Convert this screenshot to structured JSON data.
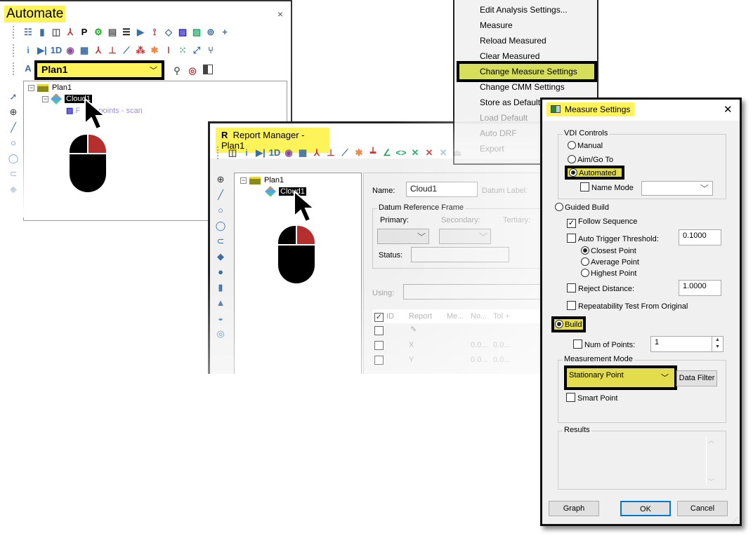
{
  "automate": {
    "title": "Automate",
    "close": "×",
    "toolbar1": [
      "report-icon",
      "page-icon",
      "camera-icon",
      "axis-icon",
      "P",
      "probe-icon",
      "document-icon",
      "list-icon",
      "play-icon",
      "robot-icon",
      "tag-icon",
      "scan-icon",
      "scan-color-icon",
      "target-icon",
      "plus-icon"
    ],
    "toolbar2": [
      "info-icon",
      "step-icon",
      "1D",
      "eye-icon",
      "grid-icon",
      "axis-circle-icon",
      "axis-square-icon",
      "chart-icon",
      "multi-circle-icon",
      "color-icon",
      "thermometer-icon",
      "dots-icon",
      "arrows-icon",
      "branch-icon"
    ],
    "plan_select": "Plan1",
    "tree": {
      "plan": "Plan1",
      "cloud": "Cloud1",
      "scan_prefix": "F",
      "scan": "4 points - scan"
    }
  },
  "report_manager": {
    "title": "Report Manager - Plan1",
    "title_icon": "R",
    "toolbar": [
      "camera-icon",
      "info-icon",
      "step-icon",
      "1D",
      "eye-icon",
      "grid-icon",
      "axis-circle-icon",
      "axis-square-icon",
      "chart-icon",
      "color-icon",
      "ruler-icon",
      "angle-icon",
      "code-icon",
      "cross-icon",
      "cross2-icon",
      "cross3-icon",
      "export-icon"
    ],
    "tree": {
      "plan": "Plan1",
      "cloud": "Cloud1"
    },
    "name_label": "Name:",
    "name_value": "Cloud1",
    "datum_label": "Datum Label:",
    "drf_group": "Datum Reference Frame",
    "primary": "Primary:",
    "secondary": "Secondary:",
    "tertiary": "Tertiary:",
    "status": "Status:",
    "using": "Using:",
    "columns": [
      "ID",
      "Report",
      "Me...",
      "No...",
      "Tol +"
    ],
    "rows": [
      {
        "report": "X",
        "nom": "0.0...",
        "tol": "0.0..."
      },
      {
        "report": "Y",
        "nom": "0.0...",
        "tol": "0.0..."
      }
    ]
  },
  "context_menu": {
    "items": [
      {
        "label": "Edit Analysis Settings...",
        "enabled": true
      },
      {
        "label": "Measure",
        "enabled": true
      },
      {
        "label": "Reload Measured",
        "enabled": true
      },
      {
        "label": "Clear Measured",
        "enabled": true
      },
      {
        "label": "Change Measure Settings",
        "enabled": true,
        "highlighted": true
      },
      {
        "label": "Change CMM Settings",
        "enabled": true
      },
      {
        "label": "Store as Default",
        "enabled": true
      },
      {
        "label": "Load Default",
        "enabled": false
      },
      {
        "label": "Auto DRF",
        "enabled": false
      },
      {
        "label": "Export",
        "enabled": false
      }
    ]
  },
  "measure_settings": {
    "title": "Measure Settings",
    "close": "✕",
    "vdi_group": "VDI Controls",
    "manual": "Manual",
    "aim_goto": "Aim/Go To",
    "automated": "Automated",
    "name_mode": "Name Mode",
    "guided_build": "Guided Build",
    "follow_sequence": "Follow Sequence",
    "auto_trigger": "Auto Trigger Threshold:",
    "auto_trigger_value": "0.1000",
    "closest": "Closest Point",
    "average": "Average Point",
    "highest": "Highest Point",
    "reject_distance": "Reject Distance:",
    "reject_value": "1.0000",
    "repeatability": "Repeatability Test From Original",
    "build": "Build",
    "num_points": "Num of Points:",
    "num_points_value": "1",
    "mode_group": "Measurement Mode",
    "mode_value": "Stationary Point",
    "data_filter": "Data Filter",
    "smart_point": "Smart Point",
    "results_group": "Results",
    "graph": "Graph",
    "ok": "OK",
    "cancel": "Cancel"
  },
  "colors": {
    "highlight": "#fff35a",
    "menu_highlight": "#d7df5a",
    "mouse_right": "#b52f2f"
  }
}
